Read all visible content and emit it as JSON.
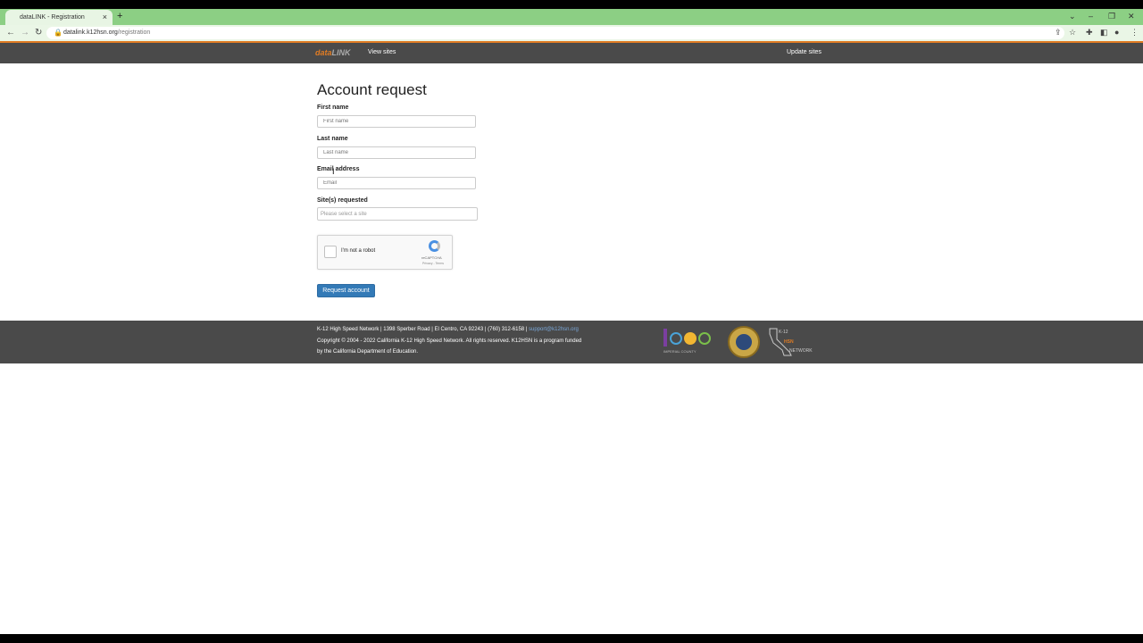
{
  "browser": {
    "tab_title": "dataLINK - Registration",
    "tab_close": "×",
    "new_tab": "+",
    "url_host": "datalink.k12hsn.org",
    "url_path": "/registration",
    "win_min": "–",
    "win_max": "❐",
    "win_close": "✕",
    "chevron": "⌄",
    "nav_back": "←",
    "nav_fwd": "→",
    "nav_reload": "↻",
    "lock": "🔒",
    "share": "⇪",
    "star": "☆",
    "puzzle": "✚",
    "sidepanel": "◧",
    "profile": "●",
    "menu": "⋮"
  },
  "nav": {
    "brand_a": "data",
    "brand_b": "LINK",
    "view_sites": "View sites",
    "update_sites": "Update sites"
  },
  "form": {
    "title": "Account request",
    "first_name_label": "First name",
    "first_name_placeholder": "First name",
    "last_name_label": "Last name",
    "last_name_placeholder": "Last name",
    "email_label": "Email address",
    "email_placeholder": "Email",
    "sites_label": "Site(s) requested",
    "sites_placeholder": "Please select a site",
    "captcha_text": "I'm not a robot",
    "captcha_brand": "reCAPTCHA",
    "captcha_terms": "Privacy - Terms",
    "submit": "Request account"
  },
  "footer": {
    "line1": "K-12 High Speed Network | 1398 Sperber Road | El Centro, CA 92243 | (760) 312-6158 |",
    "line1_link": "support@k12hsn.org",
    "line2": "Copyright © 2004 - 2022 California K-12 High Speed Network. All rights reserved. K12HSN is a program funded",
    "line3": "by the California Department of Education.",
    "logo1_sub": "IMPERIAL COUNTY",
    "hsn_l1": "K-12",
    "hsn_l2": "HSN",
    "hsn_l3": "NETWORK"
  },
  "colors": {
    "accent": "#e07c24",
    "nav_bg": "#4a4a4a",
    "button": "#337ab7",
    "tabbar": "#8ccf84"
  }
}
